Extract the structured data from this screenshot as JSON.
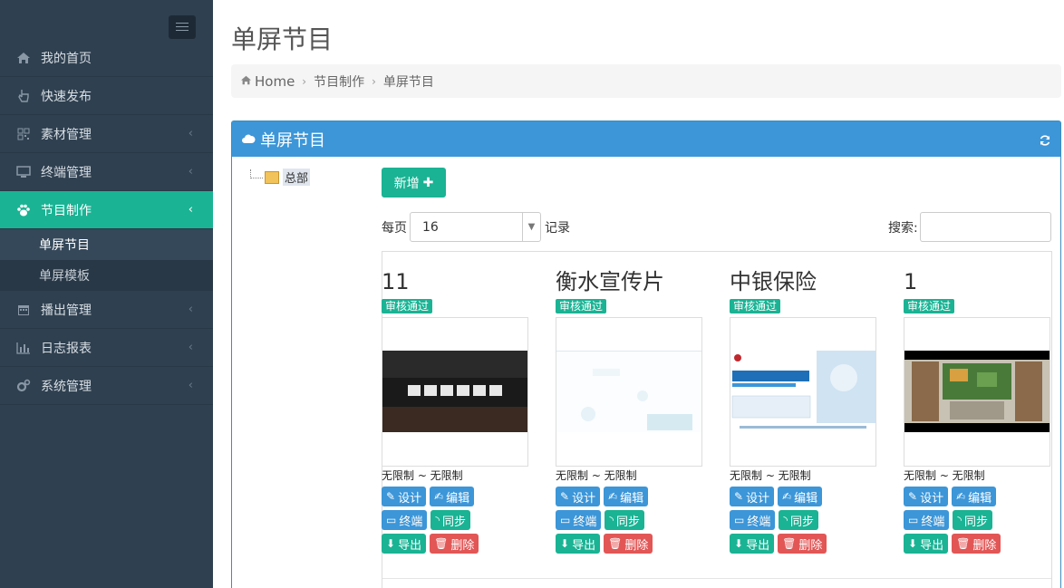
{
  "sidebar": {
    "items": [
      {
        "label": "我的首页",
        "icon": "home-icon"
      },
      {
        "label": "快速发布",
        "icon": "hand-pointer-icon"
      },
      {
        "label": "素材管理",
        "icon": "qrcode-icon"
      },
      {
        "label": "终端管理",
        "icon": "desktop-icon"
      },
      {
        "label": "节目制作",
        "icon": "paw-icon"
      },
      {
        "label": "播出管理",
        "icon": "calendar-icon"
      },
      {
        "label": "日志报表",
        "icon": "bar-chart-icon"
      },
      {
        "label": "系统管理",
        "icon": "cogs-icon"
      }
    ],
    "sub_items": [
      {
        "label": "单屏节目"
      },
      {
        "label": "单屏模板"
      }
    ]
  },
  "page": {
    "title": "单屏节目",
    "breadcrumb": {
      "home": "Home",
      "parent": "节目制作",
      "current": "单屏节目"
    }
  },
  "panel": {
    "title": "单屏节目",
    "tree_root": "总部",
    "add_label": "新增",
    "per_page_label": "每页",
    "per_page_value": "16",
    "records_label": "记录",
    "search_label": "搜索:",
    "search_value": ""
  },
  "cards": [
    {
      "title": "11",
      "status": "审核通过",
      "range": "无限制 ~ 无限制"
    },
    {
      "title": "衡水宣传片",
      "status": "审核通过",
      "range": "无限制 ~ 无限制"
    },
    {
      "title": "中银保险",
      "status": "审核通过",
      "range": "无限制 ~ 无限制"
    },
    {
      "title": "1",
      "status": "审核通过",
      "range": "无限制 ~ 无限制"
    }
  ],
  "card_actions": {
    "design": "设计",
    "edit": "编辑",
    "terminal": "终端",
    "sync": "同步",
    "export": "导出",
    "delete": "删除"
  },
  "colors": {
    "sidebar_bg": "#2f4050",
    "accent_green": "#1ab394",
    "panel_blue": "#3c96d8",
    "danger_red": "#e25656"
  }
}
